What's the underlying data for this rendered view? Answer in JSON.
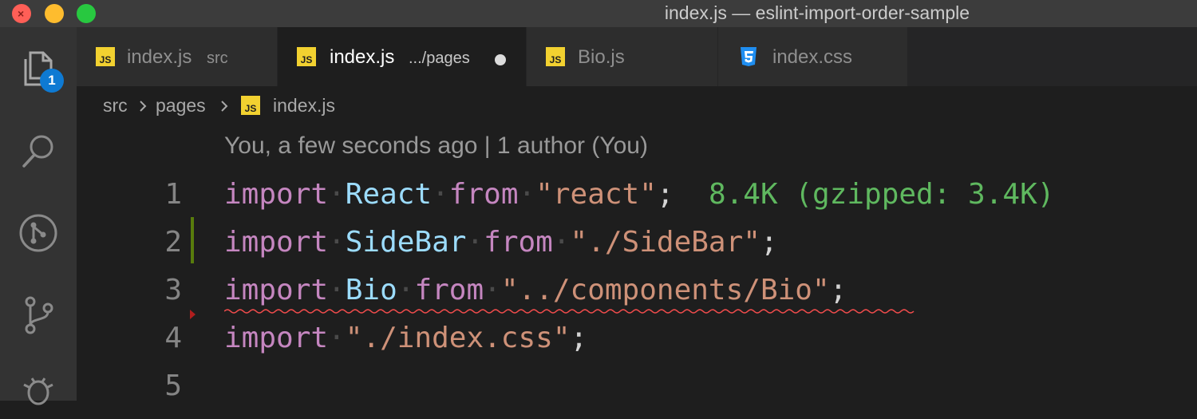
{
  "window": {
    "title": "index.js — eslint-import-order-sample"
  },
  "activity_bar": {
    "items": [
      {
        "name": "explorer",
        "icon": "files-icon",
        "badge": "1"
      },
      {
        "name": "search",
        "icon": "search-icon"
      },
      {
        "name": "git-history",
        "icon": "git-icon"
      },
      {
        "name": "source-control",
        "icon": "source-control-icon"
      },
      {
        "name": "debug",
        "icon": "bug-icon"
      }
    ]
  },
  "tabs": [
    {
      "icon": "js-file-icon",
      "label": "index.js",
      "description": "src",
      "active": false
    },
    {
      "icon": "js-file-icon",
      "label": "index.js",
      "description": ".../pages",
      "active": true,
      "dirty": true
    },
    {
      "icon": "js-file-icon",
      "label": "Bio.js",
      "description": "",
      "active": false
    },
    {
      "icon": "css-file-icon",
      "label": "index.css",
      "description": "",
      "active": false
    }
  ],
  "breadcrumb": {
    "segments": [
      "src",
      "pages",
      "index.js"
    ]
  },
  "codelens": "You, a few seconds ago | 1 author (You)",
  "code": {
    "lines": [
      {
        "number": "1",
        "keyword": "import",
        "identifier": "React",
        "from": "from",
        "string": "\"react\"",
        "punct": ";",
        "hint": "8.4K (gzipped: 3.4K)"
      },
      {
        "number": "2",
        "keyword": "import",
        "identifier": "SideBar",
        "from": "from",
        "string": "\"./SideBar\"",
        "punct": ";"
      },
      {
        "number": "3",
        "keyword": "import",
        "identifier": "Bio",
        "from": "from",
        "string": "\"../components/Bio\"",
        "punct": ";"
      },
      {
        "number": "4",
        "keyword": "import",
        "string": "\"./index.css\"",
        "punct": ";"
      },
      {
        "number": "5"
      }
    ]
  },
  "colors": {
    "keyword": "#c586c0",
    "identifier": "#9cdcfe",
    "string": "#ce9178",
    "size_hint": "#5fb85f",
    "git_modified": "#587c0c",
    "error": "#f14c4c",
    "badge": "#0e7ad3"
  }
}
